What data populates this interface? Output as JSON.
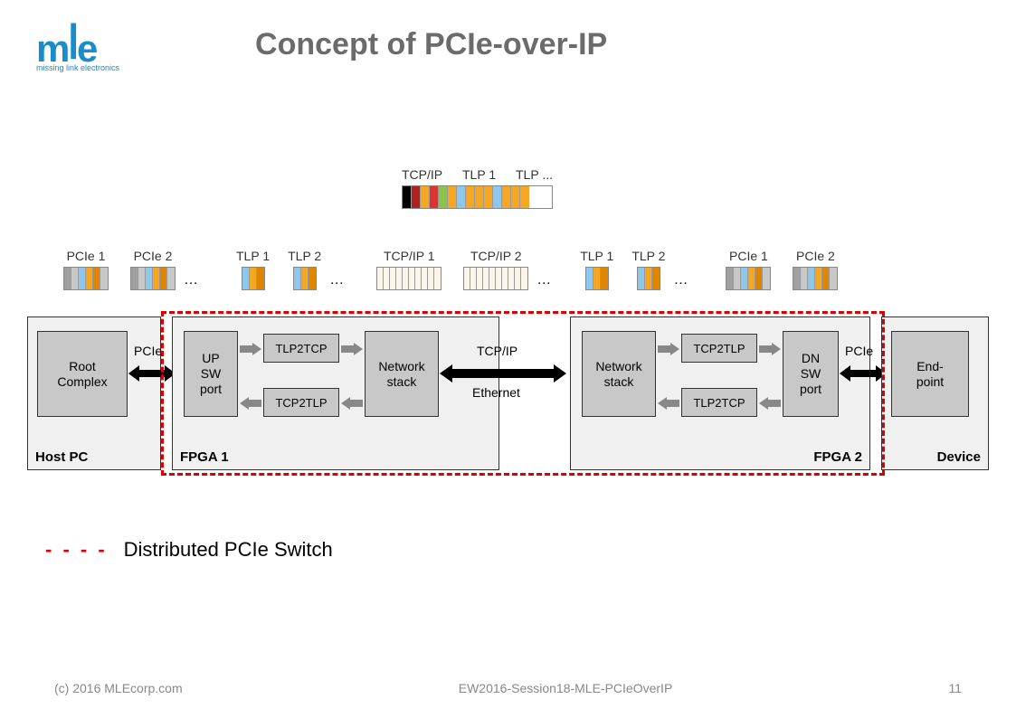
{
  "logo": {
    "text": "mle",
    "tagline": "missing link electronics"
  },
  "title": "Concept of PCIe-over-IP",
  "top_packet": {
    "labels": [
      "TCP/IP",
      "TLP 1",
      "TLP ..."
    ]
  },
  "row_labels": {
    "pcie1": "PCIe 1",
    "pcie2": "PCIe 2",
    "tlp1": "TLP 1",
    "tlp2": "TLP 2",
    "tcpip1": "TCP/IP 1",
    "tcpip2": "TCP/IP 2"
  },
  "ellipsis": "…",
  "diagram": {
    "host": "Host PC",
    "fpga1": "FPGA 1",
    "fpga2": "FPGA 2",
    "device": "Device",
    "root_complex": "Root\nComplex",
    "up_sw": "UP\nSW\nport",
    "tlp2tcp": "TLP2TCP",
    "tcp2tlp": "TCP2TLP",
    "network_stack": "Network\nstack",
    "dn_sw": "DN\nSW\nport",
    "endpoint": "End-\npoint",
    "pcie": "PCIe",
    "tcpip": "TCP/IP",
    "ethernet": "Ethernet"
  },
  "legend": "Distributed PCIe Switch",
  "footer": {
    "left": "(c) 2016 MLEcorp.com",
    "center": "EW2016-Session18-MLE-PCIeOverIP",
    "right": "11"
  }
}
